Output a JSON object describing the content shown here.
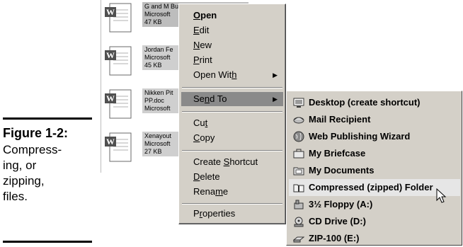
{
  "caption": {
    "figure_label": "Figure 1-2:",
    "text": "Compress-ing, or zipping, files."
  },
  "files": [
    {
      "name": "G and M Business Plan.doc",
      "type": "Microsoft",
      "size": "47 KB"
    },
    {
      "name": "Jordan Fe",
      "type": "Microsoft",
      "size": "45 KB"
    },
    {
      "name": "Nikken Pit",
      "name2": "PP.doc",
      "type": "Microsoft"
    },
    {
      "name": "Xenayout",
      "type": "Microsoft",
      "size": "27 KB"
    }
  ],
  "context_menu": {
    "open": {
      "before": "",
      "key": "O",
      "after": "pen"
    },
    "edit": {
      "before": "",
      "key": "E",
      "after": "dit"
    },
    "new": {
      "before": "",
      "key": "N",
      "after": "ew"
    },
    "print": {
      "before": "",
      "key": "P",
      "after": "rint"
    },
    "open_with": {
      "before": "Open Wit",
      "key": "h",
      "after": ""
    },
    "send_to": {
      "before": "Se",
      "key": "n",
      "after": "d To"
    },
    "cut": {
      "before": "Cu",
      "key": "t",
      "after": ""
    },
    "copy": {
      "before": "",
      "key": "C",
      "after": "opy"
    },
    "create_shortcut": {
      "before": "Create ",
      "key": "S",
      "after": "hortcut"
    },
    "delete": {
      "before": "",
      "key": "D",
      "after": "elete"
    },
    "rename": {
      "before": "Rena",
      "key": "m",
      "after": "e"
    },
    "properties": {
      "before": "P",
      "key": "r",
      "after": "operties"
    },
    "submenu_arrow": "▶"
  },
  "send_to_menu": {
    "items": [
      {
        "label": "Desktop (create shortcut)",
        "icon": "desktop-shortcut-icon"
      },
      {
        "label": "Mail Recipient",
        "icon": "mail-icon"
      },
      {
        "label": "Web Publishing Wizard",
        "icon": "globe-icon"
      },
      {
        "label": "My Briefcase",
        "icon": "briefcase-icon"
      },
      {
        "label": "My Documents",
        "icon": "folder-icon"
      },
      {
        "label": "Compressed (zipped) Folder",
        "icon": "zip-folder-icon"
      },
      {
        "label": "3½ Floppy (A:)",
        "icon": "floppy-icon"
      },
      {
        "label": "CD Drive (D:)",
        "icon": "cd-drive-icon"
      },
      {
        "label": "ZIP-100 (E:)",
        "icon": "zip-drive-icon"
      }
    ]
  },
  "colors": {
    "menu_bg": "#d4d0c8",
    "selected_bg": "#8a8a8a",
    "hover_bg": "#e6e6e6"
  }
}
